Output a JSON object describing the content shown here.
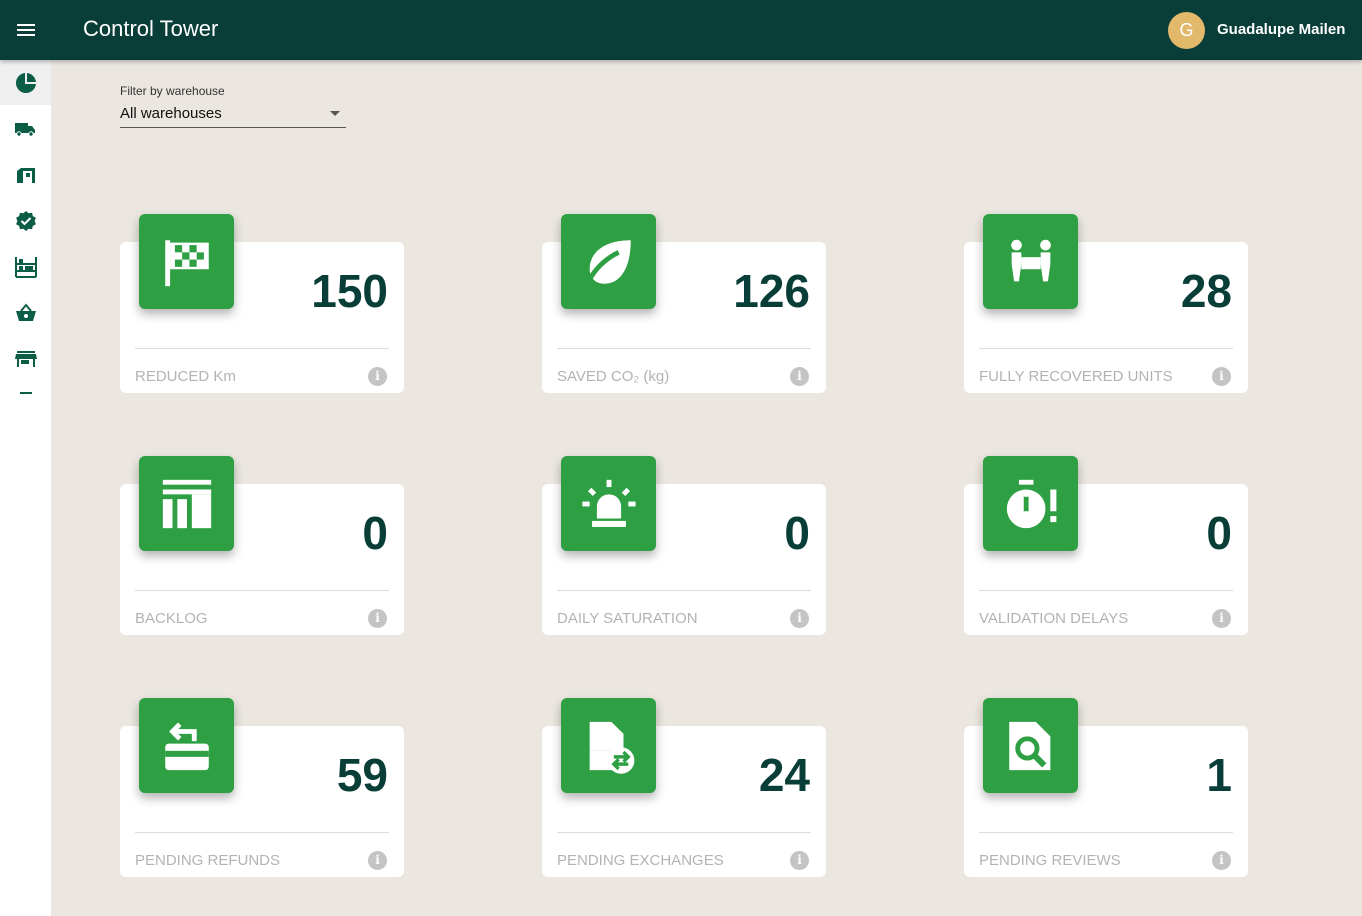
{
  "app": {
    "title": "Control Tower"
  },
  "user": {
    "initial": "G",
    "name": "Guadalupe Mailen"
  },
  "sidebar": {
    "items": [
      {
        "icon": "pie-chart-icon",
        "active": true
      },
      {
        "icon": "truck-icon"
      },
      {
        "icon": "store-door-icon"
      },
      {
        "icon": "verified-badge-icon"
      },
      {
        "icon": "warehouse-shelves-icon"
      },
      {
        "icon": "basket-icon"
      },
      {
        "icon": "storefront-icon"
      }
    ]
  },
  "filter": {
    "label": "Filter by warehouse",
    "value": "All warehouses"
  },
  "cards": [
    {
      "value": "150",
      "label": "REDUCED Km",
      "icon": "checkered-flag-icon"
    },
    {
      "value": "126",
      "label": "SAVED CO₂ (kg)",
      "icon": "leaf-icon"
    },
    {
      "value": "28",
      "label": "FULLY RECOVERED UNITS",
      "icon": "people-carrying-box-icon"
    },
    {
      "value": "0",
      "label": "BACKLOG",
      "icon": "backlog-columns-icon"
    },
    {
      "value": "0",
      "label": "DAILY SATURATION",
      "icon": "siren-icon"
    },
    {
      "value": "0",
      "label": "VALIDATION DELAYS",
      "icon": "stopwatch-alert-icon"
    },
    {
      "value": "59",
      "label": "PENDING REFUNDS",
      "icon": "card-refund-icon"
    },
    {
      "value": "24",
      "label": "PENDING EXCHANGES",
      "icon": "document-exchange-icon"
    },
    {
      "value": "1",
      "label": "PENDING REVIEWS",
      "icon": "document-search-icon"
    }
  ],
  "colors": {
    "topbar": "#083d38",
    "accent": "#2ea043",
    "background": "#ebe7e0",
    "avatar": "#e2b86a",
    "value_text": "#083d38"
  }
}
